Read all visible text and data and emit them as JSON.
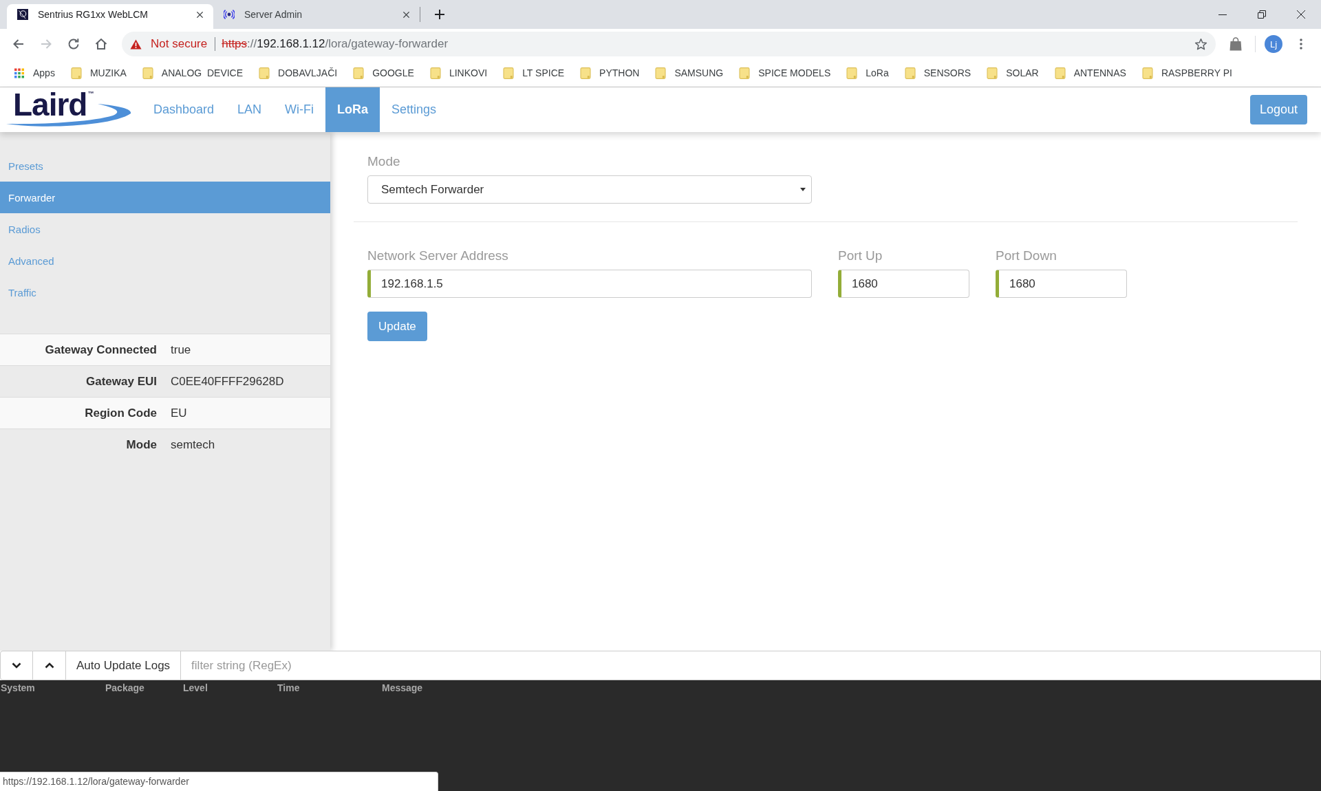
{
  "browser": {
    "tabs": [
      {
        "title": "Sentrius RG1xx WebLCM",
        "selected": true
      },
      {
        "title": "Server Admin",
        "selected": false
      }
    ],
    "toolbar_buttons": [
      {
        "kind": "back",
        "disabled": false
      },
      {
        "kind": "forward",
        "disabled": true
      },
      {
        "kind": "reload",
        "disabled": false
      },
      {
        "kind": "home",
        "disabled": false
      }
    ],
    "address": {
      "secure": false,
      "security": "Not secure",
      "scheme": "https",
      "separator": "://",
      "host": "192.168.1.12",
      "path": "/lora/gateway-forwarder"
    },
    "profile": "Lj",
    "bookmarks": [
      {
        "kind": "apps",
        "label": "Apps"
      },
      {
        "kind": "folder",
        "label": "MUZIKA"
      },
      {
        "kind": "folder",
        "label": "ANALOG  DEVICE"
      },
      {
        "kind": "folder",
        "label": "DOBAVLJAČI"
      },
      {
        "kind": "folder",
        "label": "GOOGLE"
      },
      {
        "kind": "folder",
        "label": "LINKOVI"
      },
      {
        "kind": "folder",
        "label": "LT SPICE"
      },
      {
        "kind": "folder",
        "label": "PYTHON"
      },
      {
        "kind": "folder",
        "label": "SAMSUNG"
      },
      {
        "kind": "folder",
        "label": "SPICE MODELS"
      },
      {
        "kind": "folder",
        "label": "LoRa"
      },
      {
        "kind": "folder",
        "label": "SENSORS"
      },
      {
        "kind": "folder",
        "label": "SOLAR"
      },
      {
        "kind": "folder",
        "label": "ANTENNAS"
      },
      {
        "kind": "folder",
        "label": "RASPBERRY PI"
      }
    ]
  },
  "app": {
    "logo": "Laird$^{™}$",
    "nav": [
      {
        "label": "Dashboard",
        "selected": false
      },
      {
        "label": "LAN",
        "selected": false
      },
      {
        "label": "Wi-Fi",
        "selected": false
      },
      {
        "label": "LoRa",
        "selected": true
      },
      {
        "label": "Settings",
        "selected": false
      }
    ],
    "logout": "Logout",
    "sidebar": [
      {
        "label": "Presets",
        "selected": false
      },
      {
        "label": "Forwarder",
        "selected": true
      },
      {
        "label": "Radios",
        "selected": false
      },
      {
        "label": "Advanced",
        "selected": false
      },
      {
        "label": "Traffic",
        "selected": false
      }
    ],
    "info": [
      {
        "label": "Gateway Connected",
        "value": "true"
      },
      {
        "label": "Gateway EUI",
        "value": "C0EE40FFFF29628D"
      },
      {
        "label": "Region Code",
        "value": "EU"
      },
      {
        "label": "Mode",
        "value": "semtech"
      }
    ],
    "form": {
      "mode_label": "Mode",
      "mode_value": "Semtech Forwarder",
      "fields": [
        {
          "label": "Network Server Address",
          "value": "192.168.1.5"
        },
        {
          "label": "Port Up",
          "value": "1680"
        },
        {
          "label": "Port Down",
          "value": "1680"
        }
      ],
      "submit": "Update"
    },
    "logs": {
      "auto_update": "Auto Update Logs",
      "filter_placeholder": "filter string (RegEx)",
      "columns": [
        "System",
        "Package",
        "Level",
        "Time",
        "Message"
      ]
    }
  },
  "status_url": "https://192.168.1.12/lora/gateway-forwarder"
}
